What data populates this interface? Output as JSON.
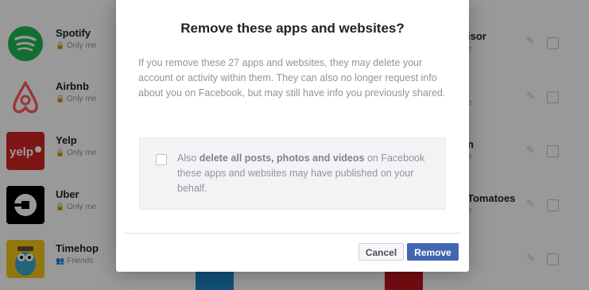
{
  "apps": [
    {
      "name": "Spotify",
      "privacy": "Only me",
      "icon": "spotify-icon",
      "privacy_icon": "lock-icon"
    },
    {
      "name": "Airbnb",
      "privacy": "Only me",
      "icon": "airbnb-icon",
      "privacy_icon": "lock-icon"
    },
    {
      "name": "Yelp",
      "privacy": "Only me",
      "icon": "yelp-icon",
      "privacy_icon": "lock-icon"
    },
    {
      "name": "Uber",
      "privacy": "Only me",
      "icon": "uber-icon",
      "privacy_icon": "lock-icon"
    },
    {
      "name": "Timehop",
      "privacy": "Friends",
      "icon": "timehop-icon",
      "privacy_icon": "friends-icon"
    }
  ],
  "right_apps": [
    {
      "name_fragment": "isor",
      "sub_fragment": "e"
    },
    {
      "name_fragment": "",
      "sub_fragment": "e"
    },
    {
      "name_fragment": "n",
      "sub_fragment": "e"
    },
    {
      "name_fragment": "Tomatoes",
      "sub_fragment": "e"
    }
  ],
  "dialog": {
    "title": "Remove these apps and websites?",
    "body": "If you remove these 27 apps and websites, they may delete your account or activity within them. They can also no longer request info about you on Facebook, but may still have info you previously shared.",
    "option_prefix": "Also ",
    "option_bold": "delete all posts, photos and videos",
    "option_suffix": " on Facebook these apps and websites may have published on your behalf.",
    "cancel_label": "Cancel",
    "remove_label": "Remove"
  },
  "colors": {
    "primary": "#4267b2",
    "spotify": "#1db954",
    "airbnb": "#ff5a5f",
    "yelp": "#d32323",
    "uber": "#000000",
    "timehop": "#f5c518"
  }
}
